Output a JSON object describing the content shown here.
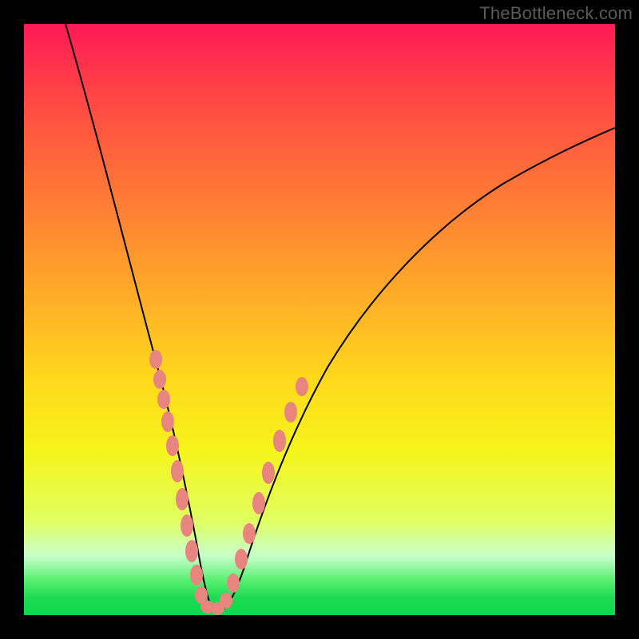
{
  "watermark": "TheBottleneck.com",
  "chart_data": {
    "type": "line",
    "title": "",
    "xlabel": "",
    "ylabel": "",
    "xlim": [
      0,
      100
    ],
    "ylim": [
      0,
      100
    ],
    "series": [
      {
        "name": "bottleneck-curve",
        "x": [
          7,
          10,
          15,
          20,
          23,
          26,
          28,
          30,
          32,
          34,
          38,
          42,
          48,
          55,
          65,
          78,
          90,
          100
        ],
        "y": [
          100,
          86,
          68,
          48,
          38,
          26,
          14,
          4,
          0,
          4,
          16,
          30,
          45,
          56,
          67,
          76,
          81,
          84
        ]
      }
    ],
    "markers": {
      "name": "beads",
      "points": [
        {
          "x": 21.8,
          "y": 44
        },
        {
          "x": 22.6,
          "y": 40
        },
        {
          "x": 23.2,
          "y": 37
        },
        {
          "x": 24.0,
          "y": 33
        },
        {
          "x": 24.8,
          "y": 29
        },
        {
          "x": 25.8,
          "y": 24
        },
        {
          "x": 26.8,
          "y": 18
        },
        {
          "x": 27.6,
          "y": 13
        },
        {
          "x": 28.4,
          "y": 8
        },
        {
          "x": 29.2,
          "y": 4
        },
        {
          "x": 30.2,
          "y": 1.5
        },
        {
          "x": 31.2,
          "y": 0.5
        },
        {
          "x": 32.4,
          "y": 0.5
        },
        {
          "x": 33.6,
          "y": 2
        },
        {
          "x": 34.8,
          "y": 6
        },
        {
          "x": 36.0,
          "y": 11
        },
        {
          "x": 37.2,
          "y": 16
        },
        {
          "x": 38.8,
          "y": 22
        },
        {
          "x": 40.4,
          "y": 28
        },
        {
          "x": 42.0,
          "y": 33
        },
        {
          "x": 43.8,
          "y": 38
        },
        {
          "x": 45.8,
          "y": 43
        }
      ]
    },
    "background_gradient": {
      "top": "#ff1955",
      "mid": "#ffd81c",
      "bottom": "#0ad94b"
    }
  }
}
